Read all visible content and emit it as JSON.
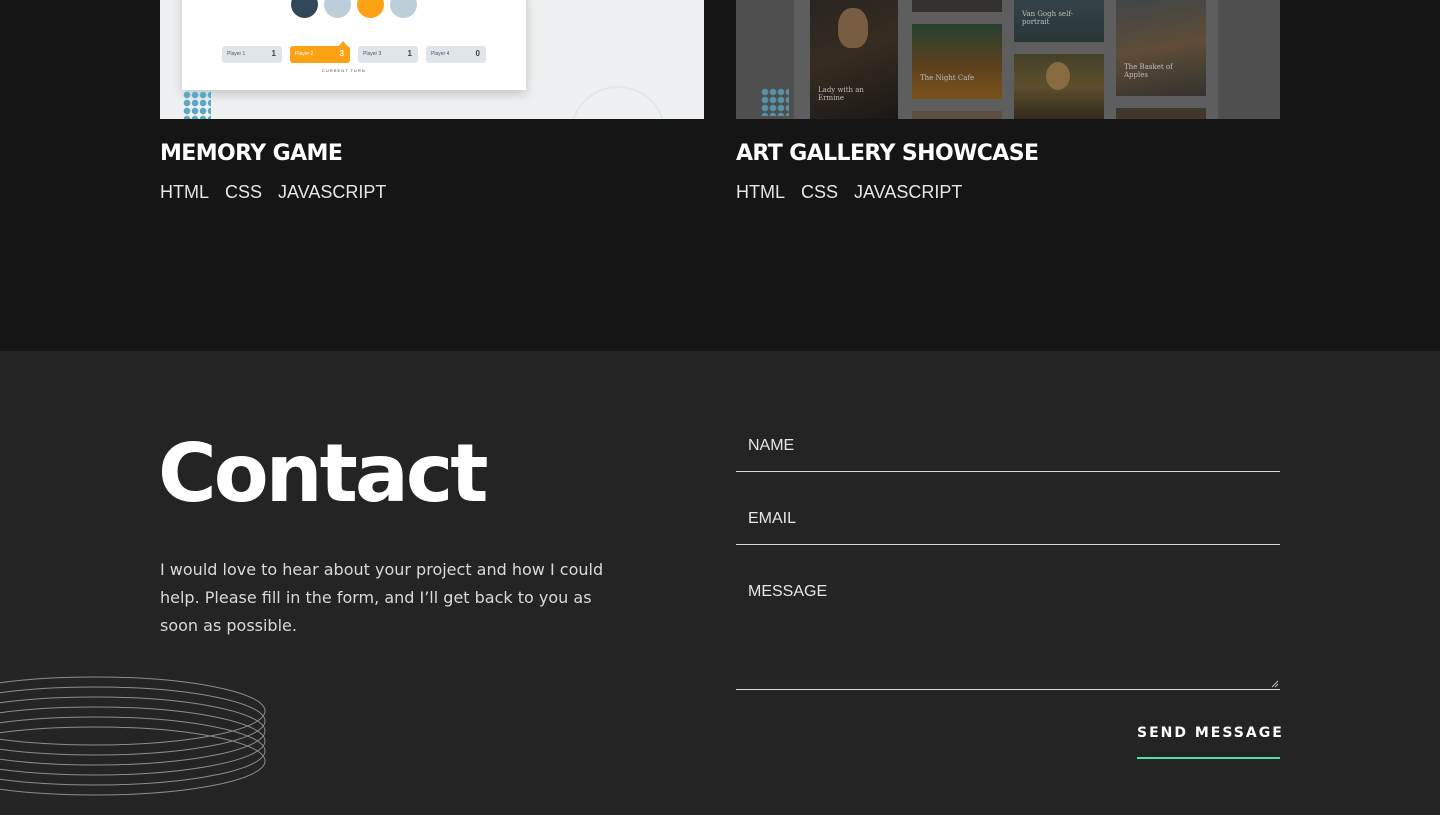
{
  "projects": [
    {
      "title": "MEMORY GAME",
      "tags": [
        "HTML",
        "CSS",
        "JAVASCRIPT"
      ],
      "thumbnail": {
        "players": [
          {
            "label": "Player 1",
            "score": "1"
          },
          {
            "label": "Player 2",
            "score": "3"
          },
          {
            "label": "Player 3",
            "score": "1"
          },
          {
            "label": "Player 4",
            "score": "0"
          }
        ],
        "current_turn": "CURRENT TURN"
      }
    },
    {
      "title": "ART GALLERY SHOWCASE",
      "tags": [
        "HTML",
        "CSS",
        "JAVASCRIPT"
      ],
      "thumbnail": {
        "captions": [
          "Lady with an Ermine",
          "The Night Cafe",
          "Van Gogh self-portrait",
          "The Basket of Apples"
        ]
      }
    }
  ],
  "contact": {
    "title": "Contact",
    "text": "I would love to hear about your project and how I could help. Please fill in the form, and I’ll get back to you as soon as possible.",
    "fields": {
      "name": "NAME",
      "email": "EMAIL",
      "message": "MESSAGE"
    },
    "submit_label": "SEND MESSAGE"
  },
  "colors": {
    "accent": "#4ee1a0",
    "projects_bg": "#151515",
    "contact_bg": "#242424"
  }
}
